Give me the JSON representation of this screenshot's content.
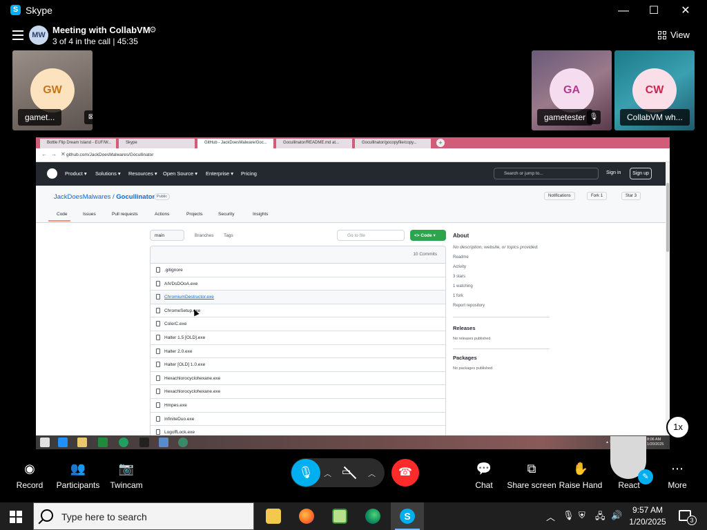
{
  "window": {
    "title": "Skype",
    "logo_letter": "S",
    "minimize": "—",
    "maximize": "☐",
    "close": "✕"
  },
  "meeting": {
    "avatar_initials": "MW",
    "title": "Meeting with CollabVM",
    "subtitle": "3 of 4 in the call | 45:35",
    "view_label": "View"
  },
  "participants": [
    {
      "initials": "GW",
      "name": "gamet...",
      "avatar_bg": "#fde2c0",
      "avatar_fg": "#c8751a"
    },
    {
      "initials": "GA",
      "name": "gametester",
      "avatar_bg": "#f6dcef",
      "avatar_fg": "#b23a8e"
    },
    {
      "initials": "CW",
      "name": "CollabVM wh...",
      "avatar_bg": "#fbdfe8",
      "avatar_fg": "#c8264f"
    }
  ],
  "shared_screen": {
    "browser_tabs": [
      "Bottle Flip Dream Island - EUF/W...",
      "Skype",
      "GitHub - JackDoesMalware/Goc...",
      "Gocullinator/README.md at...",
      "Gocullinator/gocopyfile/copy..."
    ],
    "url": "github.com/JackDoesMalwares/Gocullinator",
    "github_nav": [
      "Product ▾",
      "Solutions ▾",
      "Resources ▾",
      "Open Source ▾",
      "Enterprise ▾",
      "Pricing"
    ],
    "search_placeholder": "Search or jump to...",
    "sign_in": "Sign in",
    "sign_up": "Sign up",
    "repo_owner": "JackDoesMalwares",
    "repo_sep": " / ",
    "repo_name": "Gocullinator",
    "visibility": "Public",
    "repo_buttons": [
      "Notifications",
      "Fork 1",
      "Star 3"
    ],
    "repo_tabs": [
      "Code",
      "Issues",
      "Pull requests",
      "Actions",
      "Projects",
      "Security",
      "Insights"
    ],
    "branch": "main",
    "branches_label": "Branches",
    "tags_label": "Tags",
    "go_to_file": "Go to file",
    "code_button": "<> Code ▾",
    "commits": "10 Commits",
    "files": [
      ".gitignore",
      "AIVDsDOoA.exe",
      "ChromiumDestructor.exe",
      "ChromeSetup.exe",
      "ColorC.exe",
      "Halter 1.5 [OLD].exe",
      "Halter 2.0.exe",
      "Halter [OLD] 1.0.exe",
      "Hexachlorocyclohexane.exe",
      "Hexachlorocyclohexane.exe",
      "Hmpes.exe",
      "InfiniteDuo.exe",
      "LogoffLock.exe"
    ],
    "about_heading": "About",
    "about_text": "No description, website, or topics provided.",
    "about_items": [
      "Readme",
      "Activity",
      "3 stars",
      "1 watching",
      "1 fork",
      "Report repository"
    ],
    "releases_heading": "Releases",
    "releases_text": "No releases published",
    "packages_heading": "Packages",
    "packages_text": "No packages published",
    "inner_clock": "8:06 AM\n1/20/2025",
    "inner_tray": "▴ ⚑ ⚿ EN"
  },
  "playback_speed": "1x",
  "controls": {
    "record": "Record",
    "participants": "Participants",
    "twincam": "Twincam",
    "chat": "Chat",
    "share_screen": "Share screen",
    "raise_hand": "Raise Hand",
    "react": "React",
    "more": "More"
  },
  "taskbar": {
    "search_placeholder": "Type here to search",
    "time": "9:57 AM",
    "date": "1/20/2025",
    "notifications": "3"
  },
  "colors": {
    "skype_blue": "#00aff0",
    "end_call_red": "#ff2a2a",
    "github_green": "#2da44e",
    "github_dark": "#24292f"
  }
}
